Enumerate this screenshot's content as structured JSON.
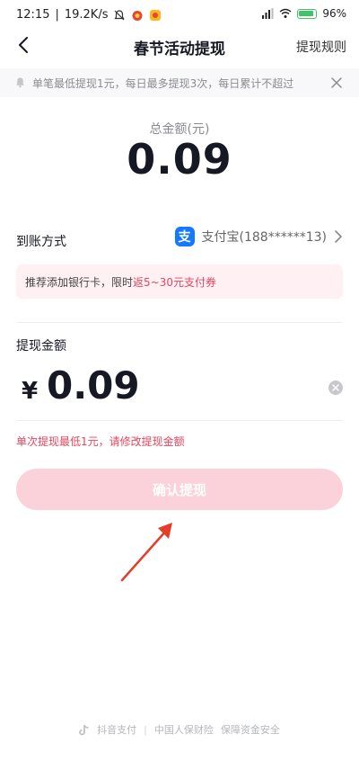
{
  "status": {
    "time": "12:15",
    "speed": "19.2K/s",
    "battery": "96"
  },
  "nav": {
    "title": "春节活动提现",
    "rules": "提现规则"
  },
  "notice": {
    "text": "单笔最低提现1元，每日最多提现3次，每日累计不超过"
  },
  "total": {
    "label": "总金额(元)",
    "amount": "0.09"
  },
  "payment": {
    "label": "到账方式",
    "icon_char": "支",
    "account": "支付宝(188******13)"
  },
  "promo": {
    "prefix": "推荐添加银行卡，限时",
    "highlight": "返5~30元支付券"
  },
  "withdraw": {
    "label": "提现金额",
    "currency": "¥",
    "value": "0.09",
    "error": "单次提现最低1元，请修改提现金额"
  },
  "confirm": {
    "label": "确认提现"
  },
  "footer": {
    "brand": "抖音支付",
    "insurer": "中国人保财险",
    "guarantee": "保障资金安全"
  },
  "colors": {
    "accent": "#e8455e",
    "button_disabled": "#fbd2da",
    "alipay": "#1677ff"
  }
}
